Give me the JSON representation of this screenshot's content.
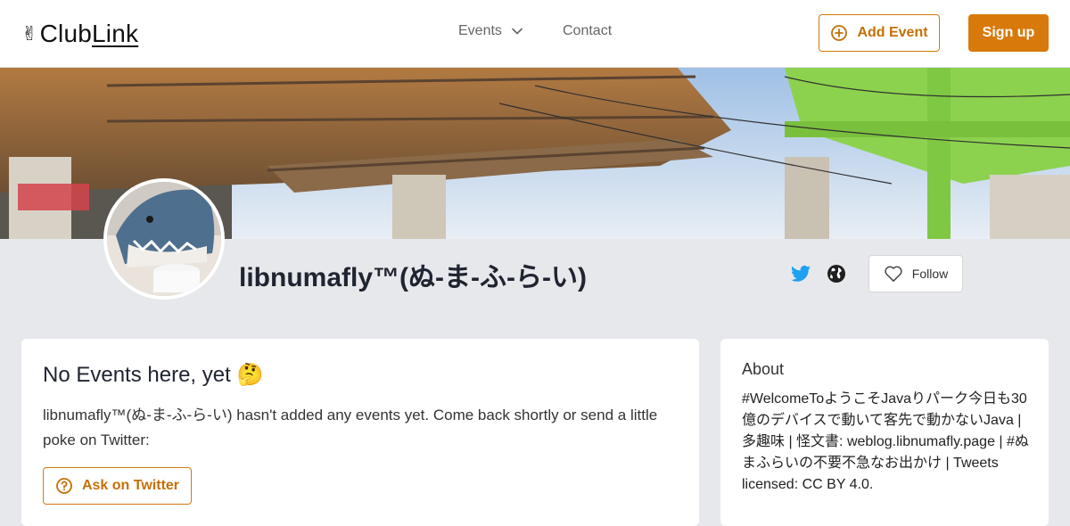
{
  "header": {
    "logo_prefix": "Club",
    "logo_suffix": "Link",
    "logo_emoji": "✌",
    "nav": {
      "events_label": "Events",
      "contact_label": "Contact"
    },
    "add_event_label": "Add Event",
    "signup_label": "Sign up"
  },
  "profile": {
    "name": "libnumafly™(ぬ-ま-ふ-ら-い)",
    "follow_label": "Follow",
    "twitter_icon": "twitter-icon",
    "website_icon": "globe-icon"
  },
  "events_card": {
    "title": "No Events here, yet",
    "title_emoji": "🤔",
    "message": "libnumafly™(ぬ-ま-ふ-ら-い) hasn't added any events yet. Come back shortly or send a little poke on Twitter:",
    "ask_label": "Ask on Twitter"
  },
  "about_card": {
    "title": "About",
    "text": "#WelcomeToようこそJavaりパーク今日も30億のデバイスで動いて客先で動かないJava | 多趣味 | 怪文書: weblog.libnumafly.page | #ぬまふらいの不要不急なお出かけ | Tweets licensed: CC BY 4.0."
  },
  "colors": {
    "accent": "#d87a0b",
    "twitter": "#1da1f2",
    "page_bg": "#e7e8ec"
  }
}
